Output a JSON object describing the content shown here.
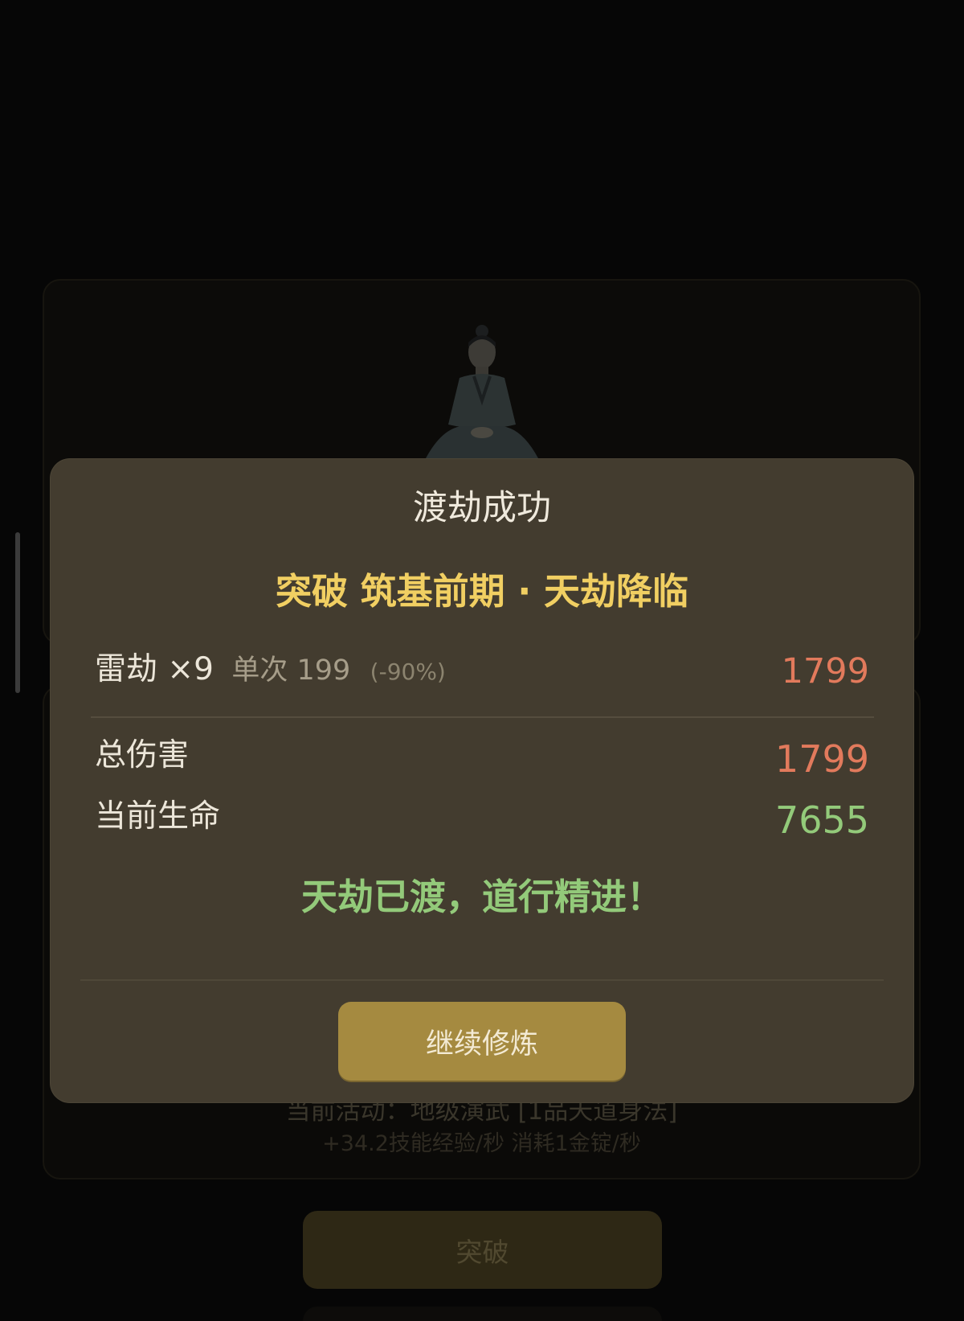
{
  "background": {
    "activity_text": "当前活动：地级演武 [1品天道身法]",
    "stats_text": "+34.2技能经验/秒  消耗1金锭/秒",
    "break_button_label": "突破"
  },
  "modal": {
    "title": "渡劫成功",
    "subtitle": "突破 筑基前期 · 天劫降临",
    "lightning": {
      "label": "雷劫",
      "count": "×9",
      "single": "单次 199",
      "reduction": "(-90%)",
      "value": "1799"
    },
    "total_damage": {
      "label": "总伤害",
      "value": "1799"
    },
    "current_hp": {
      "label": "当前生命",
      "value": "7655"
    },
    "result_message": "天劫已渡，道行精进！",
    "continue_button_label": "继续修炼"
  },
  "colors": {
    "modal_bg": "#433c2f",
    "gold_text": "#f1cf62",
    "damage_red": "#e27a5c",
    "health_green": "#93ca7a",
    "button_gold": "#a58a40"
  }
}
